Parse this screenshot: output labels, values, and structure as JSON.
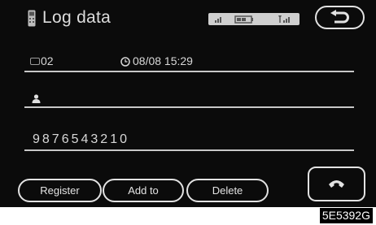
{
  "header": {
    "title": "Log data",
    "title_icon": "phone-handset-icon",
    "status_icons": [
      "signal-icon",
      "battery-icon",
      "antenna-icon"
    ],
    "back_icon": "return-arrow-icon"
  },
  "entry": {
    "line_label": "02",
    "line_icon": "phone-line-icon",
    "datetime": "08/08 15:29",
    "datetime_icon": "clock-icon",
    "name": "",
    "name_icon": "person-icon",
    "number": "9876543210"
  },
  "buttons": {
    "register": "Register",
    "add_to": "Add to",
    "delete": "Delete",
    "call_icon": "call-handset-icon"
  },
  "image_code": "5E5392G"
}
